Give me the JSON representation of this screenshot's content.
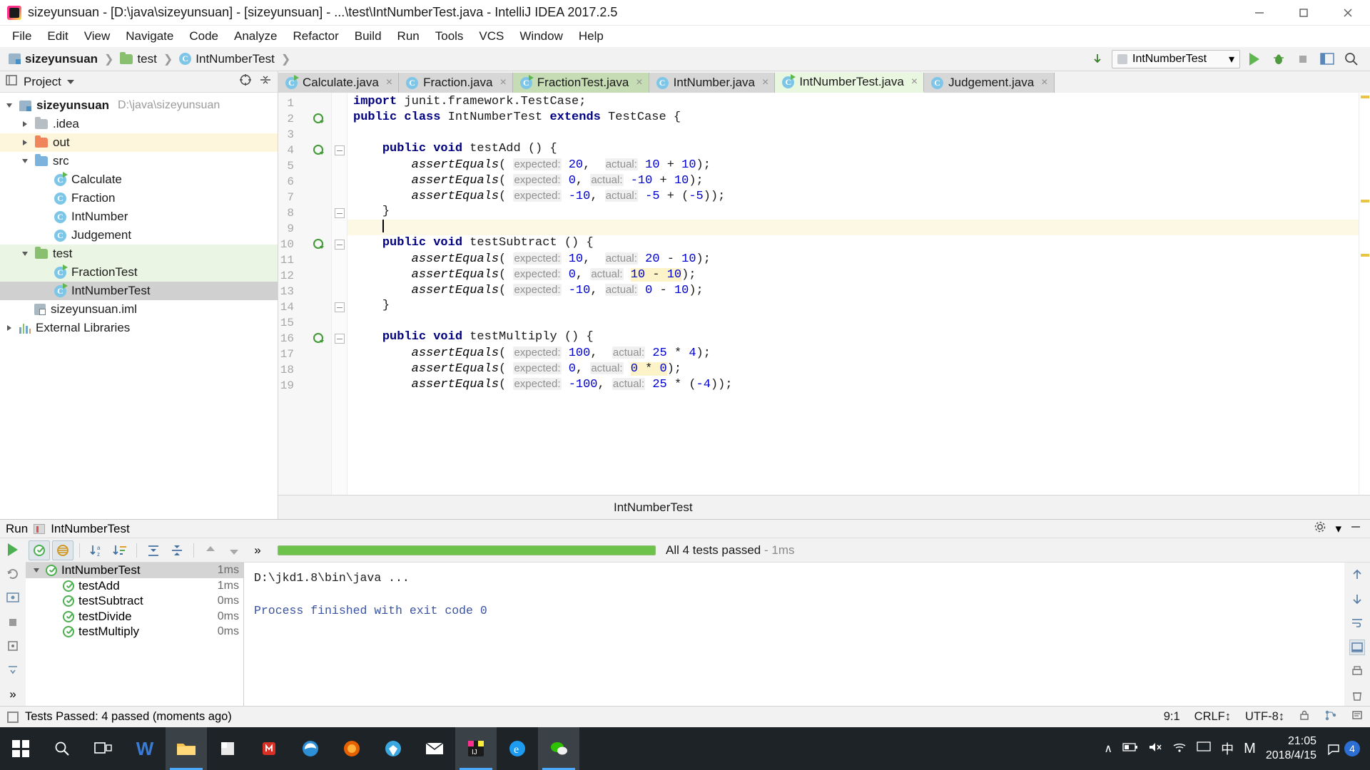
{
  "window": {
    "title": "sizeyunsuan - [D:\\java\\sizeyunsuan] - [sizeyunsuan] - ...\\test\\IntNumberTest.java - IntelliJ IDEA 2017.2.5",
    "minimize_label": "Minimize",
    "maximize_label": "Maximize",
    "close_label": "Close"
  },
  "menubar": {
    "items": [
      {
        "label": "File"
      },
      {
        "label": "Edit"
      },
      {
        "label": "View"
      },
      {
        "label": "Navigate"
      },
      {
        "label": "Code"
      },
      {
        "label": "Analyze"
      },
      {
        "label": "Refactor"
      },
      {
        "label": "Build"
      },
      {
        "label": "Run"
      },
      {
        "label": "Tools"
      },
      {
        "label": "VCS"
      },
      {
        "label": "Window"
      },
      {
        "label": "Help"
      }
    ]
  },
  "breadcrumb": {
    "items": [
      {
        "label": "sizeyunsuan",
        "icon": "module-icon"
      },
      {
        "label": "test",
        "icon": "folder-icon"
      },
      {
        "label": "IntNumberTest",
        "icon": "class-icon"
      }
    ]
  },
  "run_config": {
    "name": "IntNumberTest",
    "run_label": "Run",
    "debug_label": "Debug",
    "stop_label": "Stop",
    "layout_label": "Restore Layout",
    "search_label": "Search Everywhere"
  },
  "sidebar": {
    "title": "Project",
    "collapse_label": "Collapse All",
    "settings_label": "Settings",
    "hide_label": "Hide",
    "tree": [
      {
        "label": "sizeyunsuan",
        "path": "D:\\java\\sizeyunsuan",
        "icon": "module-icon",
        "depth": 0,
        "arrow": "down",
        "style": "bold"
      },
      {
        "label": ".idea",
        "icon": "folder-grey-icon",
        "depth": 1,
        "arrow": "right",
        "style": ""
      },
      {
        "label": "out",
        "icon": "folder-orange-icon",
        "depth": 1,
        "arrow": "right",
        "style": "",
        "highlight": "yellow"
      },
      {
        "label": "src",
        "icon": "folder-blue-icon",
        "depth": 1,
        "arrow": "down",
        "style": ""
      },
      {
        "label": "Calculate",
        "icon": "class-runnable-icon",
        "depth": 2,
        "arrow": "",
        "style": ""
      },
      {
        "label": "Fraction",
        "icon": "class-icon",
        "depth": 2,
        "arrow": "",
        "style": ""
      },
      {
        "label": "IntNumber",
        "icon": "class-icon",
        "depth": 2,
        "arrow": "",
        "style": ""
      },
      {
        "label": "Judgement",
        "icon": "class-icon",
        "depth": 2,
        "arrow": "",
        "style": ""
      },
      {
        "label": "test",
        "icon": "folder-green-icon",
        "depth": 1,
        "arrow": "down",
        "style": "",
        "highlight": "green"
      },
      {
        "label": "FractionTest",
        "icon": "class-runnable-icon",
        "depth": 2,
        "arrow": "",
        "style": "",
        "highlight": "green"
      },
      {
        "label": "IntNumberTest",
        "icon": "class-runnable-icon",
        "depth": 2,
        "arrow": "",
        "style": "",
        "highlight": "selected"
      },
      {
        "label": "sizeyunsuan.iml",
        "icon": "iml-icon",
        "depth": 1,
        "arrow": "",
        "style": ""
      },
      {
        "label": "External Libraries",
        "icon": "library-icon",
        "depth": 0,
        "arrow": "right",
        "style": ""
      }
    ]
  },
  "editor": {
    "tabs": [
      {
        "label": "Calculate.java",
        "icon": "class-runnable-icon",
        "state": "normal",
        "close": "×"
      },
      {
        "label": "Fraction.java",
        "icon": "class-icon",
        "state": "normal",
        "close": "×"
      },
      {
        "label": "FractionTest.java",
        "icon": "class-runnable-icon",
        "state": "green",
        "close": "×"
      },
      {
        "label": "IntNumber.java",
        "icon": "class-icon",
        "state": "normal",
        "close": "×"
      },
      {
        "label": "IntNumberTest.java",
        "icon": "class-runnable-icon",
        "state": "active",
        "close": "×"
      },
      {
        "label": "Judgement.java",
        "icon": "class-icon",
        "state": "normal",
        "close": "×"
      }
    ],
    "breadcrumb_footer": "IntNumberTest",
    "lines": [
      {
        "n": 1,
        "gutter": "",
        "fold": "",
        "current": false
      },
      {
        "n": 2,
        "gutter": "run",
        "fold": "",
        "current": false
      },
      {
        "n": 3,
        "gutter": "",
        "fold": "",
        "current": false
      },
      {
        "n": 4,
        "gutter": "run",
        "fold": "open",
        "current": false
      },
      {
        "n": 5,
        "gutter": "",
        "fold": "",
        "current": false
      },
      {
        "n": 6,
        "gutter": "",
        "fold": "",
        "current": false
      },
      {
        "n": 7,
        "gutter": "",
        "fold": "",
        "current": false
      },
      {
        "n": 8,
        "gutter": "",
        "fold": "close",
        "current": false
      },
      {
        "n": 9,
        "gutter": "",
        "fold": "",
        "current": true
      },
      {
        "n": 10,
        "gutter": "run",
        "fold": "open",
        "current": false
      },
      {
        "n": 11,
        "gutter": "",
        "fold": "",
        "current": false
      },
      {
        "n": 12,
        "gutter": "",
        "fold": "",
        "current": false
      },
      {
        "n": 13,
        "gutter": "",
        "fold": "",
        "current": false
      },
      {
        "n": 14,
        "gutter": "",
        "fold": "close",
        "current": false
      },
      {
        "n": 15,
        "gutter": "",
        "fold": "",
        "current": false
      },
      {
        "n": 16,
        "gutter": "run",
        "fold": "open",
        "current": false
      },
      {
        "n": 17,
        "gutter": "",
        "fold": "",
        "current": false
      },
      {
        "n": 18,
        "gutter": "",
        "fold": "",
        "current": false
      },
      {
        "n": 19,
        "gutter": "",
        "fold": "",
        "current": false
      }
    ],
    "code_lines": [
      "import junit.framework.TestCase;",
      "public class IntNumberTest extends TestCase {",
      "",
      "    public void testAdd () {",
      "        assertEquals( expected: 20,  actual: 10 + 10);",
      "        assertEquals( expected: 0, actual: -10 + 10);",
      "        assertEquals( expected: -10, actual: -5 + (-5));",
      "    }",
      "",
      "    public void testSubtract () {",
      "        assertEquals( expected: 10,  actual: 20 - 10);",
      "        assertEquals( expected: 0, actual: 10 - 10);",
      "        assertEquals( expected: -10, actual: 0 - 10);",
      "    }",
      "",
      "    public void testMultiply () {",
      "        assertEquals( expected: 100,  actual: 25 * 4);",
      "        assertEquals( expected: 0, actual: 0 * 0);",
      "        assertEquals( expected: -100, actual: 25 * (-4));"
    ]
  },
  "run_panel": {
    "header_label": "Run",
    "header_config": "IntNumberTest",
    "settings_label": "Settings",
    "hide_label": "Hide",
    "toolbar": {
      "rerun_label": "Rerun",
      "show_passed_label": "Show Passed",
      "show_ignored_label": "Show Ignored",
      "sort_alpha_label": "Sort Alphabetically",
      "sort_duration_label": "Sort by Duration",
      "expand_label": "Expand All",
      "collapse_label": "Collapse All",
      "prev_label": "Previous Failed Test",
      "next_label": "Next Failed Test",
      "more_label": "»"
    },
    "progress": {
      "percent": 100,
      "status": "All 4 tests passed",
      "duration": "- 1ms"
    },
    "tests": [
      {
        "label": "IntNumberTest",
        "time": "1ms",
        "depth": 0,
        "root": true
      },
      {
        "label": "testAdd",
        "time": "1ms",
        "depth": 1,
        "root": false
      },
      {
        "label": "testSubtract",
        "time": "0ms",
        "depth": 1,
        "root": false
      },
      {
        "label": "testDivide",
        "time": "0ms",
        "depth": 1,
        "root": false
      },
      {
        "label": "testMultiply",
        "time": "0ms",
        "depth": 1,
        "root": false
      }
    ],
    "console": {
      "command": "D:\\jkd1.8\\bin\\java ...",
      "result": "Process finished with exit code 0"
    }
  },
  "statusbar": {
    "message": "Tests Passed: 4 passed (moments ago)",
    "caret": "9:1",
    "line_sep": "CRLF↕",
    "encoding": "UTF-8↕",
    "lock_label": "Read-only toggle",
    "git_label": "Git"
  },
  "taskbar": {
    "start_label": "Start",
    "search_label": "Search",
    "taskview_label": "Task View",
    "items": [
      {
        "name": "word-icon",
        "label": "W",
        "color": "#2b579a",
        "active": false
      },
      {
        "name": "file-explorer-icon",
        "label": "",
        "color": "#f6c350",
        "active": true
      },
      {
        "name": "store-icon",
        "label": "",
        "color": "#f2f2f2",
        "active": false
      },
      {
        "name": "app-red-icon",
        "label": "",
        "color": "#d93025",
        "active": false
      },
      {
        "name": "edge-icon",
        "label": "e",
        "color": "#1d9bf0",
        "active": false
      },
      {
        "name": "firefox-icon",
        "label": "",
        "color": "#e66000",
        "active": false
      },
      {
        "name": "browser-icon",
        "label": "",
        "color": "#3ba7e0",
        "active": false
      },
      {
        "name": "mail-icon",
        "label": "",
        "color": "#ffffff",
        "active": false
      },
      {
        "name": "intellij-icon",
        "label": "IJ",
        "color": "#ff318c",
        "active": true
      },
      {
        "name": "ie-icon",
        "label": "e",
        "color": "#1d9bf0",
        "active": false
      },
      {
        "name": "wechat-icon",
        "label": "",
        "color": "#2dc100",
        "active": true
      }
    ],
    "tray": {
      "chevron": "∧",
      "battery_label": "Battery",
      "volume_label": "Volume",
      "network_label": "Network",
      "keyboard_label": "中",
      "ime_label": "M",
      "time": "21:05",
      "date": "2018/4/15",
      "notification_count": "4"
    }
  }
}
